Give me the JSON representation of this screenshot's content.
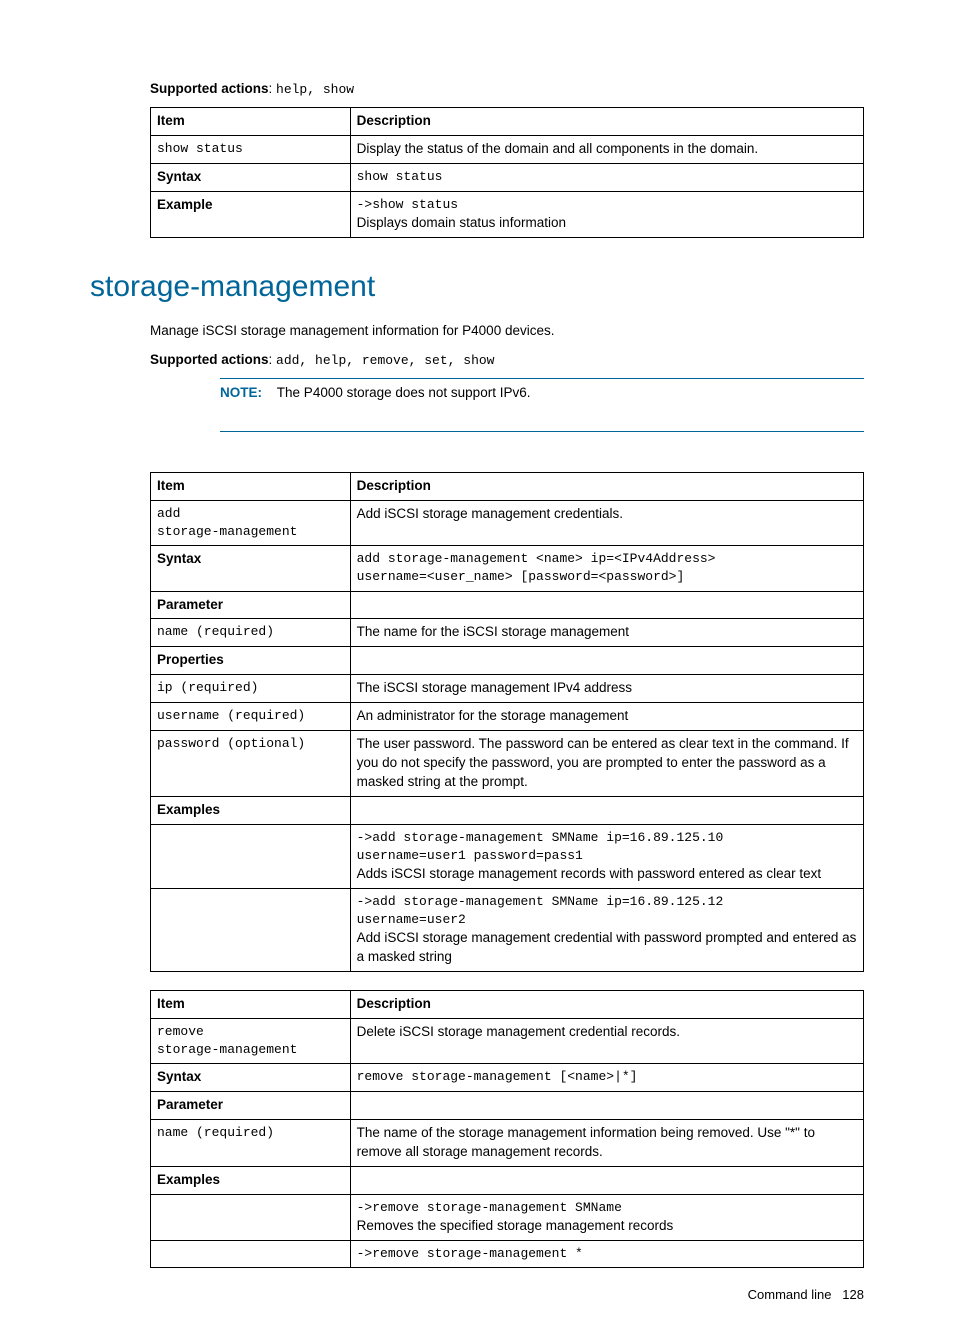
{
  "status_section": {
    "supported_actions_label": "Supported actions",
    "supported_actions_value": "help, show",
    "table": {
      "header_item": "Item",
      "header_desc": "Description",
      "row1_item": "show status",
      "row1_desc": "Display the status of the domain and all components in the domain.",
      "row2_item": "Syntax",
      "row2_desc": "show status",
      "row3_item": "Example",
      "row3_cmd": "->show status",
      "row3_desc": "Displays domain status information"
    }
  },
  "storage_mgmt": {
    "title": "storage-management",
    "intro": "Manage iSCSI storage management information for P4000 devices.",
    "supported_actions_label": "Supported actions",
    "supported_actions_value": "add, help, remove, set, show",
    "note_label": "NOTE:",
    "note_text": "The P4000 storage does not support IPv6.",
    "table_add": {
      "header_item": "Item",
      "header_desc": "Description",
      "cmd_line1": "add",
      "cmd_line2": "storage-management",
      "cmd_desc": "Add iSCSI storage management credentials.",
      "syntax_label": "Syntax",
      "syntax_line1": "add storage-management <name> ip=<IPv4Address>",
      "syntax_line2": "username=<user_name> [password=<password>]",
      "parameter_label": "Parameter",
      "param_name": "name (required)",
      "param_name_desc": "The name for the iSCSI storage management",
      "properties_label": "Properties",
      "prop_ip": "ip (required)",
      "prop_ip_desc": "The iSCSI storage management IPv4 address",
      "prop_username": "username (required)",
      "prop_username_desc": "An administrator for the storage management",
      "prop_password": "password (optional)",
      "prop_password_desc": "The user password. The password can be entered as clear text in the command. If you do not specify the password, you are prompted to enter the password as a masked string at the prompt.",
      "examples_label": "Examples",
      "ex1_line1": "->add storage-management SMName ip=16.89.125.10",
      "ex1_line2": "username=user1 password=pass1",
      "ex1_desc": "Adds iSCSI storage management records with password entered as clear text",
      "ex2_line1": "->add storage-management SMName ip=16.89.125.12",
      "ex2_line2": "username=user2",
      "ex2_desc": "Add iSCSI storage management credential with password prompted and entered as a masked string"
    },
    "table_remove": {
      "header_item": "Item",
      "header_desc": "Description",
      "cmd_line1": "remove",
      "cmd_line2": "storage-management",
      "cmd_desc": "Delete iSCSI storage management credential records.",
      "syntax_label": "Syntax",
      "syntax_value": "remove storage-management [<name>|*]",
      "parameter_label": "Parameter",
      "param_name": "name (required)",
      "param_name_desc": "The name of the storage management information being removed. Use \"*\" to remove all storage management records.",
      "examples_label": "Examples",
      "ex1_cmd": "->remove storage-management SMName",
      "ex1_desc": "Removes the specified storage management records",
      "ex2_cmd": "->remove storage-management *"
    }
  },
  "footer": {
    "text": "Command line",
    "page": "128"
  }
}
